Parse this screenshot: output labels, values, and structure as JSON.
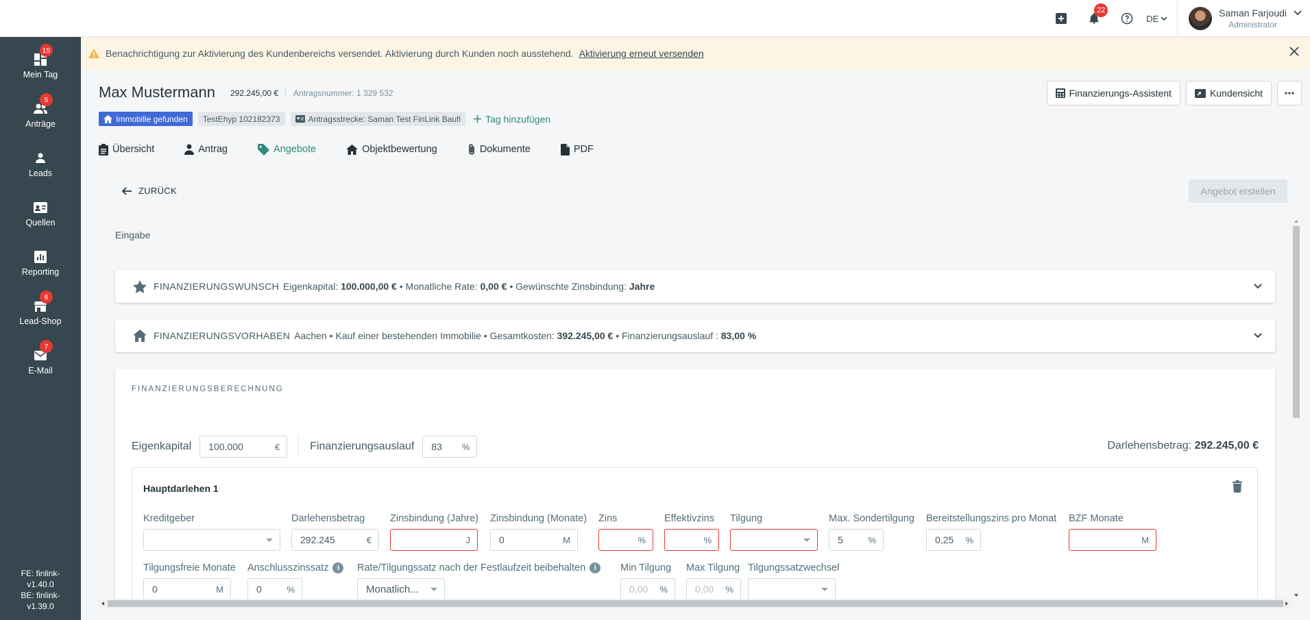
{
  "topbar": {
    "notification_count": "22",
    "language": "DE",
    "user_name": "Saman Farjoudi",
    "user_role": "Administrator"
  },
  "sidebar": {
    "items": [
      {
        "label": "Mein Tag",
        "badge": "15",
        "icon": "dashboard-icon"
      },
      {
        "label": "Anträge",
        "badge": "5",
        "icon": "users-icon"
      },
      {
        "label": "Leads",
        "badge": "",
        "icon": "person-icon"
      },
      {
        "label": "Quellen",
        "badge": "",
        "icon": "id-card-icon"
      },
      {
        "label": "Reporting",
        "badge": "",
        "icon": "chart-icon"
      },
      {
        "label": "Lead-Shop",
        "badge": "6",
        "icon": "store-icon"
      },
      {
        "label": "E-Mail",
        "badge": "7",
        "icon": "mail-icon"
      }
    ],
    "version_fe_1": "FE: finlink-",
    "version_fe_2": "v1.40.0",
    "version_be_1": "BE: finlink-",
    "version_be_2": "v1.39.0"
  },
  "notice": {
    "text": "Benachrichtigung zur Aktivierung des Kundenbereichs versendet. Aktivierung durch Kunden noch ausstehend.",
    "link": "Aktivierung erneut versenden"
  },
  "header": {
    "name": "Max Mustermann",
    "sum": "292.245,00 €",
    "antragsnummer": "Antragsnummer: 1 329 532",
    "tag_found": "Immobilie gefunden",
    "tag_test": "TestEhyp 102182373",
    "tag_strecke": "Antragsstrecke: Saman Test FinLink Baufi",
    "tag_add": "Tag hinzufügen",
    "btn_assistent": "Finanzierungs-Assistent",
    "btn_kundensicht": "Kundensicht"
  },
  "tabs": [
    {
      "label": "Übersicht"
    },
    {
      "label": "Antrag"
    },
    {
      "label": "Angebote"
    },
    {
      "label": "Objektbewertung"
    },
    {
      "label": "Dokumente"
    },
    {
      "label": "PDF"
    }
  ],
  "back_label": "ZURÜCK",
  "create_offer_label": "Angebot erstellen",
  "section_label": "Eingabe",
  "wunsch": {
    "title": "FINANZIERUNGSWUNSCH",
    "ek_label": "Eigenkapital:",
    "ek_value": "100.000,00 €",
    "rate_label": "• Monatliche Rate:",
    "rate_value": "0,00 €",
    "zins_label": "• Gewünschte Zinsbindung:",
    "zins_value": "Jahre"
  },
  "vorhaben": {
    "title": "FINANZIERUNGSVORHABEN",
    "text": "Aachen • Kauf einer bestehenden Immobilie • Gesamtkosten:",
    "kosten": "392.245,00 €",
    "auslauf_label": "• Finanzierungsauslauf :",
    "auslauf": "83,00 %"
  },
  "calc": {
    "title": "FINANZIERUNGSBERECHNUNG",
    "ek_label": "Eigenkapital",
    "ek_value": "100.000",
    "ek_unit": "€",
    "auslauf_label": "Finanzierungsauslauf",
    "auslauf_value": "83",
    "auslauf_unit": "%",
    "darlehen_label": "Darlehensbetrag:",
    "darlehen_value": "292.245,00 €"
  },
  "hauptdarlehen": {
    "title": "Hauptdarlehen 1",
    "fields": {
      "kreditgeber": {
        "label": "Kreditgeber",
        "value": ""
      },
      "darlehensbetrag": {
        "label": "Darlehensbetrag",
        "value": "292.245",
        "unit": "€"
      },
      "zinsbindung_jahre": {
        "label": "Zinsbindung (Jahre)",
        "value": "",
        "unit": "J"
      },
      "zinsbindung_monate": {
        "label": "Zinsbindung (Monate)",
        "value": "0",
        "unit": "M"
      },
      "zins": {
        "label": "Zins",
        "value": "",
        "unit": "%"
      },
      "effektivzins": {
        "label": "Effektivzins",
        "value": "",
        "unit": "%"
      },
      "tilgung": {
        "label": "Tilgung",
        "value": ""
      },
      "max_sondertilgung": {
        "label": "Max. Sondertilgung",
        "value": "5",
        "unit": "%"
      },
      "bereitstellungszins": {
        "label": "Bereitstellungszins pro Monat",
        "value": "0,25",
        "unit": "%"
      },
      "bzf_monate": {
        "label": "BZF Monate",
        "value": "",
        "unit": "M"
      },
      "tilgungsfreie_monate": {
        "label": "Tilgungsfreie Monate",
        "value": "0",
        "unit": "M"
      },
      "anschlusszinssatz": {
        "label": "Anschlusszinssatz",
        "value": "0",
        "unit": "%"
      },
      "rate_beibehalten": {
        "label": "Rate/Tilgungssatz nach der Festlaufzeit beibehalten",
        "value": "Monatlich..."
      },
      "min_tilgung": {
        "label": "Min Tilgung",
        "placeholder": "0,00",
        "unit": "%"
      },
      "max_tilgung": {
        "label": "Max Tilgung",
        "placeholder": "0,00",
        "unit": "%"
      },
      "tilgungssatzwechsel": {
        "label": "Tilgungssatzwechsel",
        "value": ""
      }
    }
  },
  "colors": {
    "sidebar": "#37474f",
    "accent": "#2e8b7a",
    "badge": "#e53935",
    "tag_blue": "#3f6ad8",
    "error": "#e53935",
    "notice_bg": "#fdf5e4"
  }
}
